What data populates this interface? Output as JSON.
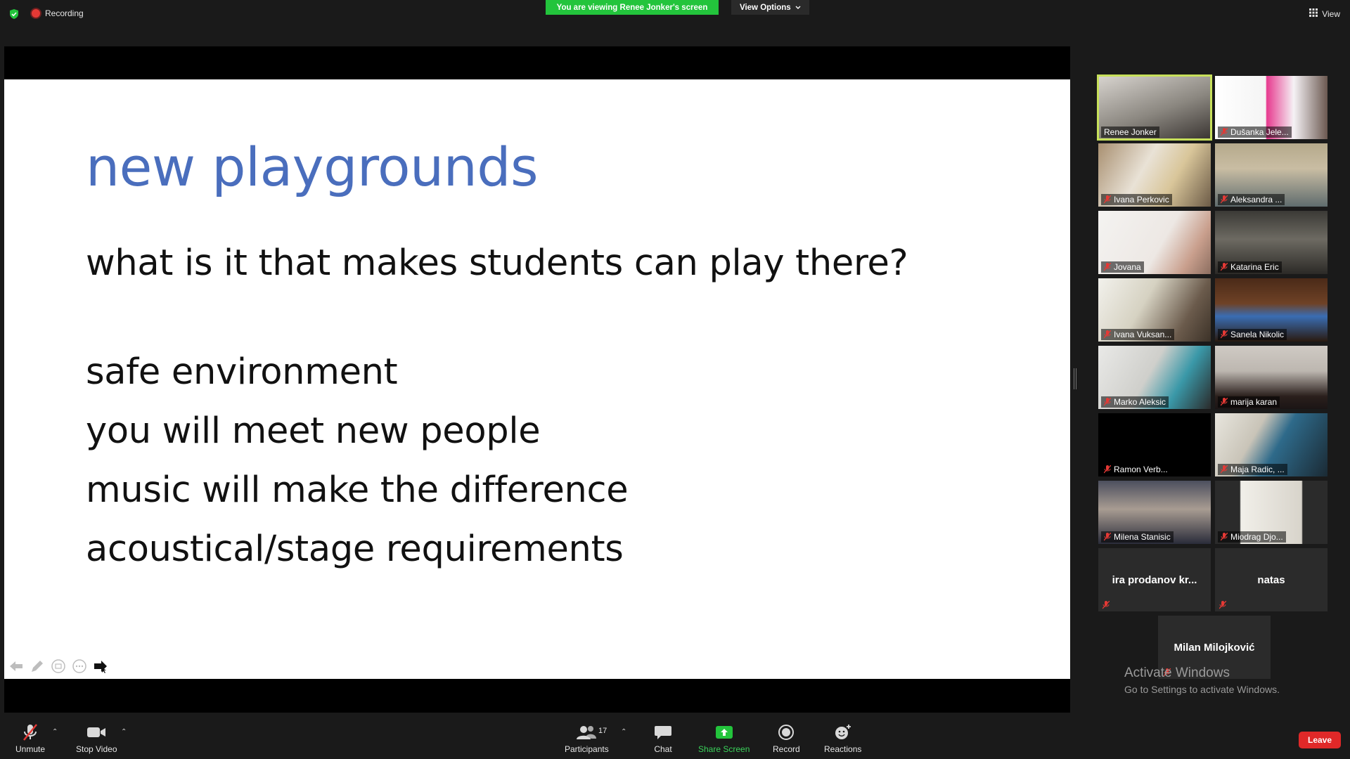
{
  "top_bar": {
    "recording_label": "Recording",
    "viewing_banner": "You are viewing Renee Jonker's screen",
    "view_options_label": "View Options",
    "view_label": "View"
  },
  "slide": {
    "title": "new playgrounds",
    "question": "what is it that makes students can play there?",
    "bullets": [
      "safe environment",
      "you will meet new people",
      "music will make the difference",
      "acoustical/stage requirements"
    ]
  },
  "participants": [
    {
      "name": "Renee Jonker",
      "muted": false,
      "video": true,
      "active": true
    },
    {
      "name": "Dušanka Jele...",
      "muted": true,
      "video": true
    },
    {
      "name": "Ivana Perkovic",
      "muted": true,
      "video": true
    },
    {
      "name": "Aleksandra ...",
      "muted": true,
      "video": true
    },
    {
      "name": "Jovana",
      "muted": true,
      "video": true
    },
    {
      "name": "Katarina Eric",
      "muted": true,
      "video": true
    },
    {
      "name": "Ivana Vuksan...",
      "muted": true,
      "video": true
    },
    {
      "name": "Sanela Nikolic",
      "muted": true,
      "video": true
    },
    {
      "name": "Marko Aleksic",
      "muted": true,
      "video": true
    },
    {
      "name": "marija karan",
      "muted": true,
      "video": true
    },
    {
      "name": "Ramon Verb...",
      "muted": true,
      "video": false
    },
    {
      "name": "Maja Radic, ...",
      "muted": true,
      "video": true
    },
    {
      "name": "Milena Stanisic",
      "muted": true,
      "video": true
    },
    {
      "name": "Miodrag Djo...",
      "muted": true,
      "video": true
    },
    {
      "name": "ira prodanov kr...",
      "muted": true,
      "video": false
    },
    {
      "name": "natas",
      "muted": true,
      "video": false
    },
    {
      "name": "Milan Milojković",
      "muted": true,
      "video": false
    }
  ],
  "watermark": {
    "title": "Activate Windows",
    "subtitle": "Go to Settings to activate Windows."
  },
  "toolbar": {
    "unmute": "Unmute",
    "stop_video": "Stop Video",
    "participants": "Participants",
    "participants_count": "17",
    "chat": "Chat",
    "share_screen": "Share Screen",
    "record": "Record",
    "reactions": "Reactions",
    "leave": "Leave"
  },
  "colors": {
    "banner_green": "#23c43c",
    "slide_title_blue": "#4a6ebd",
    "active_speaker": "#c7e05a",
    "leave_red": "#e02828",
    "share_green": "#3ad15a"
  }
}
